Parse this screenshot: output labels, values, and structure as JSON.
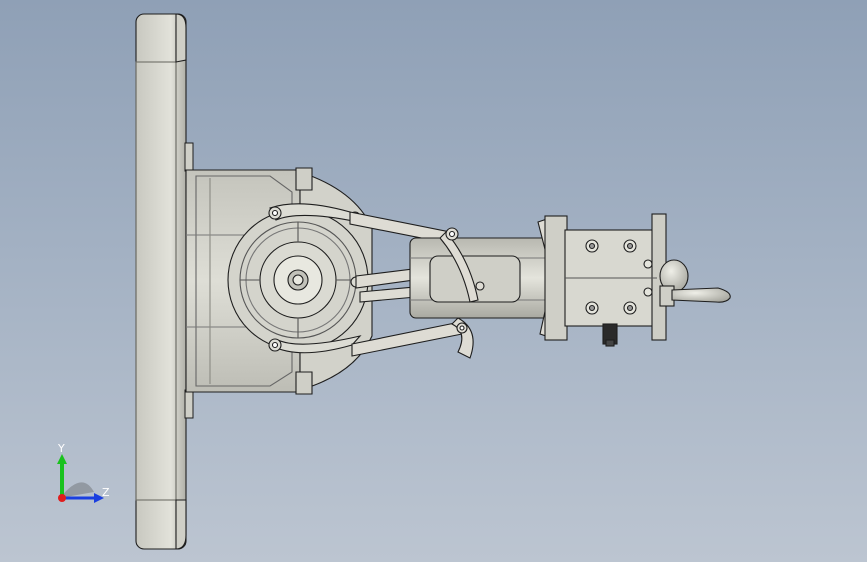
{
  "viewport": {
    "background_top": "#8fa0b6",
    "background_bottom": "#bcc5d1",
    "model_fill": "#d7d7cf",
    "model_shade": "#b9b9b0",
    "edge_color": "#1e1e1e"
  },
  "triad": {
    "x_label": "",
    "y_label": "Y",
    "z_label": "Z",
    "y_color": "#19c21e",
    "z_color": "#1a3fe0",
    "origin_color": "#e01c1c"
  }
}
